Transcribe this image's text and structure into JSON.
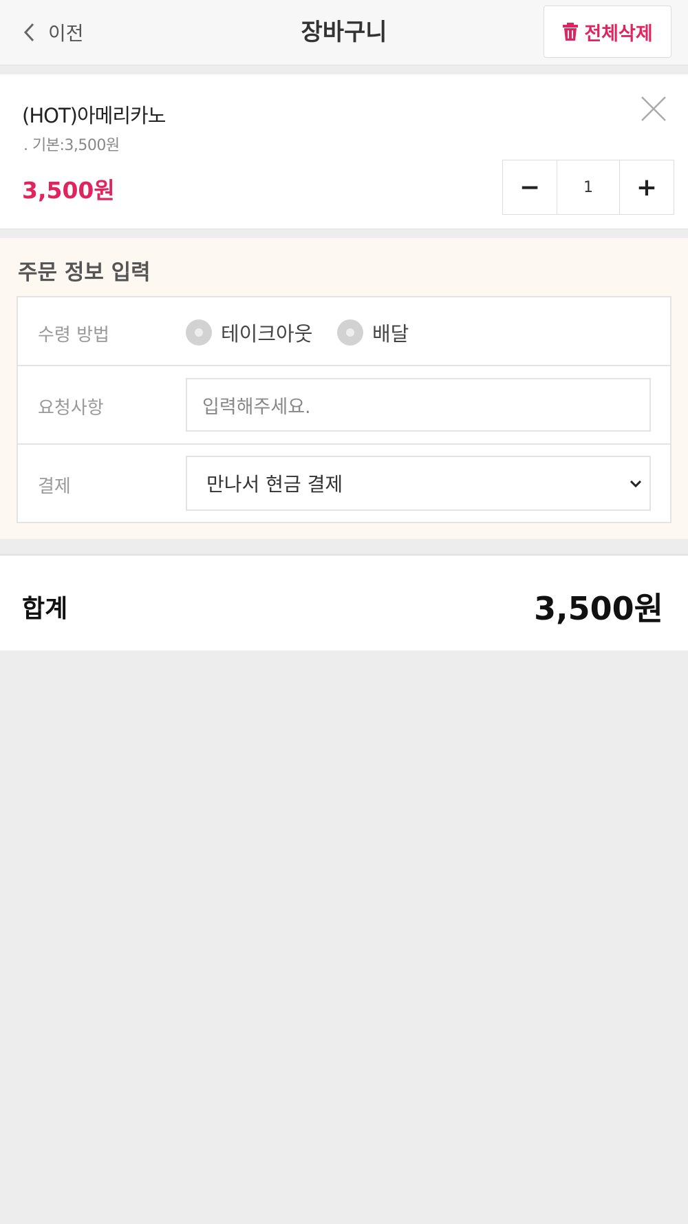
{
  "header": {
    "back_label": "이전",
    "title": "장바구니",
    "delete_all_label": "전체삭제"
  },
  "cart": {
    "items": [
      {
        "name": "(HOT)아메리카노",
        "option": ". 기본:3,500원",
        "price": "3,500원",
        "quantity": "1",
        "minus": "−",
        "plus": "+"
      }
    ]
  },
  "order_info": {
    "title": "주문 정보 입력",
    "receive_method_label": "수령 방법",
    "receive_options": [
      "테이크아웃",
      "배달"
    ],
    "request_label": "요청사항",
    "request_placeholder": "입력해주세요.",
    "payment_label": "결제",
    "payment_selected": "만나서 현금 결제"
  },
  "total": {
    "label": "합계",
    "value": "3,500원"
  },
  "colors": {
    "accent": "#e0245e",
    "section_bg": "#fdf9f2",
    "page_bg": "#ededed"
  }
}
